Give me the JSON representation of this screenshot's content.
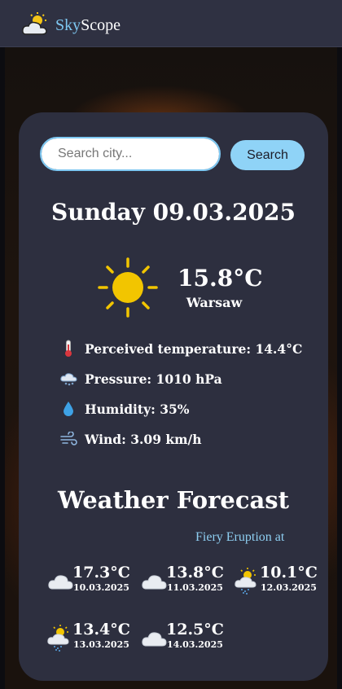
{
  "header": {
    "brand_part1": "Sky",
    "brand_part2": "Scope",
    "logo_icon": "cloud-sun-icon"
  },
  "search": {
    "placeholder": "Search city...",
    "button_label": "Search"
  },
  "current": {
    "date": "Sunday 09.03.2025",
    "icon": "sun-icon",
    "temperature": "15.8°C",
    "city": "Warsaw",
    "details": [
      {
        "icon": "thermometer-icon",
        "text": "Perceived temperature: 14.4°C"
      },
      {
        "icon": "pressure-icon",
        "text": "Pressure: 1010 hPa"
      },
      {
        "icon": "droplet-icon",
        "text": "Humidity: 35%"
      },
      {
        "icon": "wind-icon",
        "text": "Wind: 3.09 km/h"
      }
    ]
  },
  "forecast": {
    "title": "Weather Forecast",
    "ticker": "Fiery Eruption at",
    "days": [
      {
        "temp": "17.3°C",
        "date": "10.03.2025",
        "icon": "cloud-icon"
      },
      {
        "temp": "13.8°C",
        "date": "11.03.2025",
        "icon": "cloud-icon"
      },
      {
        "temp": "10.1°C",
        "date": "12.03.2025",
        "icon": "sun-cloud-rain-icon"
      },
      {
        "temp": "13.4°C",
        "date": "13.03.2025",
        "icon": "sun-cloud-rain-icon"
      },
      {
        "temp": "12.5°C",
        "date": "14.03.2025",
        "icon": "cloud-icon"
      }
    ]
  },
  "colors": {
    "accent": "#7ec8f2",
    "card": "#2d2f3f",
    "sun": "#f2c500"
  }
}
